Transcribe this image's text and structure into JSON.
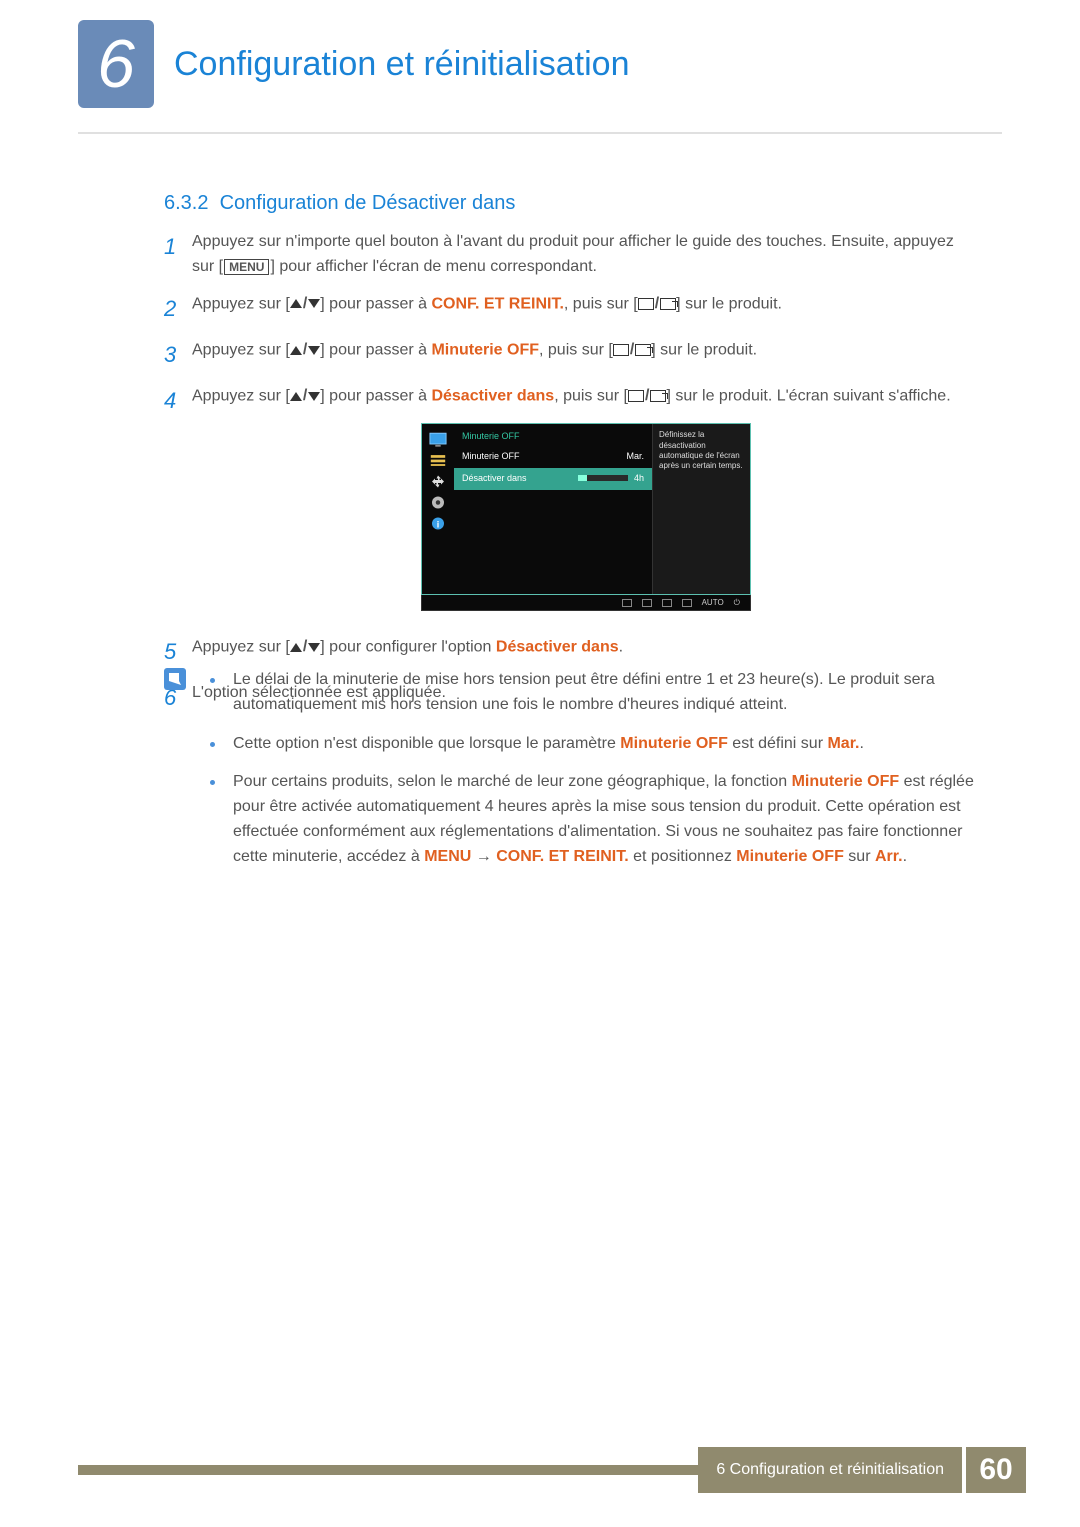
{
  "chapter": {
    "number": "6",
    "title": "Configuration et réinitialisation"
  },
  "section": {
    "number": "6.3.2",
    "title": "Configuration de Désactiver dans"
  },
  "menu_label": "MENU",
  "steps": {
    "s1": {
      "num": "1",
      "a": "Appuyez sur n'importe quel bouton à l'avant du produit pour afficher le guide des touches. Ensuite, appuyez sur [",
      "b": "] pour afficher l'écran de menu correspondant."
    },
    "s2": {
      "num": "2",
      "a": "Appuyez sur [",
      "b": "] pour passer à ",
      "hl": "CONF. ET REINIT.",
      "c": ", puis sur [",
      "d": "] sur le produit."
    },
    "s3": {
      "num": "3",
      "a": "Appuyez sur [",
      "b": "] pour passer à ",
      "hl": "Minuterie OFF",
      "c": ", puis sur [",
      "d": "] sur le produit."
    },
    "s4": {
      "num": "4",
      "a": "Appuyez sur [",
      "b": "] pour passer à ",
      "hl": "Désactiver dans",
      "c": ", puis sur [",
      "d": "] sur le produit. L'écran suivant s'affiche."
    },
    "s5": {
      "num": "5",
      "a": "Appuyez sur [",
      "b": "] pour configurer l'option ",
      "hl": "Désactiver dans",
      "c": "."
    },
    "s6": {
      "num": "6",
      "a": "L'option sélectionnée est appliquée."
    }
  },
  "osd": {
    "menu_title": "Minuterie OFF",
    "row1_label": "Minuterie OFF",
    "row1_value": "Mar.",
    "row2_label": "Désactiver dans",
    "row2_value": "4h",
    "help_text": "Définissez la désactivation automatique de l'écran après un certain temps.",
    "auto": "AUTO"
  },
  "notes": {
    "n1": "Le délai de la minuterie de mise hors tension peut être défini entre 1 et 23 heure(s). Le produit sera automatiquement mis hors tension une fois le nombre d'heures indiqué atteint.",
    "n2_a": "Cette option n'est disponible que lorsque le paramètre ",
    "n2_hl1": "Minuterie OFF",
    "n2_b": " est défini sur ",
    "n2_hl2": "Mar.",
    "n2_c": ".",
    "n3_a": "Pour certains produits, selon le marché de leur zone géographique, la fonction ",
    "n3_hl1": "Minuterie OFF",
    "n3_b": " est réglée pour être activée automatiquement 4 heures après la mise sous tension du produit. Cette opération est effectuée conformément aux réglementations d'alimentation. Si vous ne souhaitez pas faire fonctionner cette minuterie, accédez à ",
    "n3_hl2": "MENU",
    "n3_arrow": " → ",
    "n3_hl3": "CONF. ET REINIT.",
    "n3_c": " et positionnez ",
    "n3_hl4": "Minuterie OFF",
    "n3_d": " sur ",
    "n3_hl5": "Arr.",
    "n3_e": "."
  },
  "footer": {
    "label": "6 Configuration et réinitialisation",
    "page": "60"
  }
}
